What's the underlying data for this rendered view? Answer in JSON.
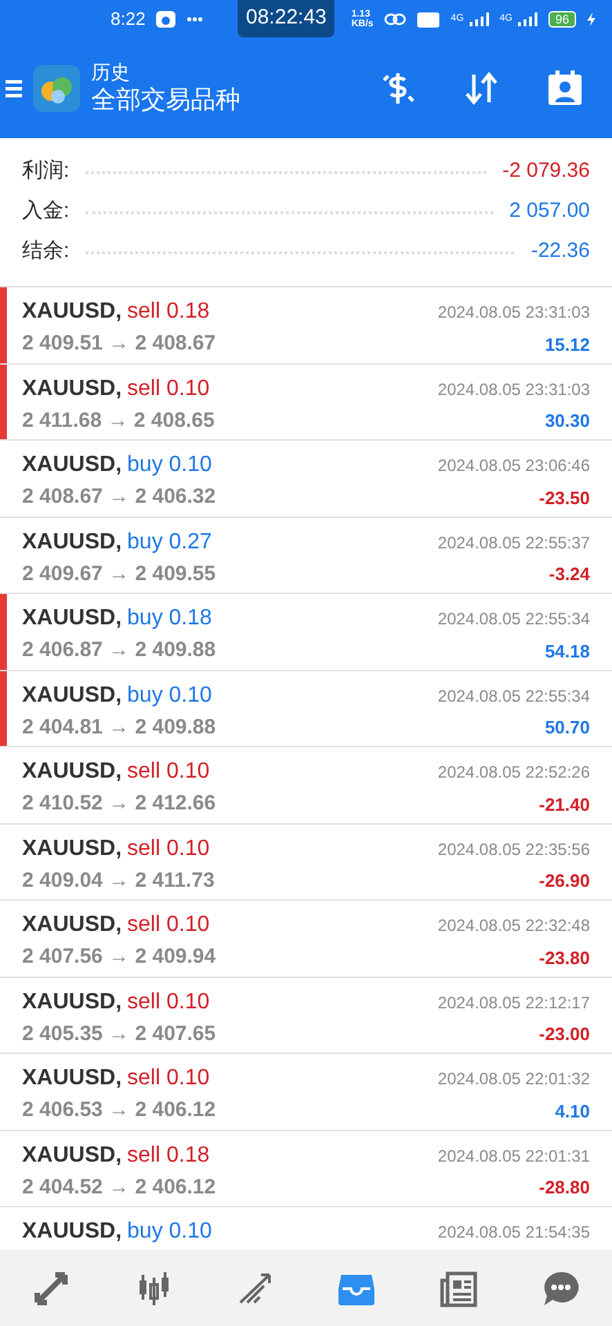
{
  "status_bar": {
    "time": "8:22",
    "clock_overlay": "08:22:43",
    "speed": "1.13\nKB/s",
    "network_1": "4G",
    "network_2": "4G",
    "battery": "96"
  },
  "header": {
    "subtitle": "历史",
    "title": "全部交易品种"
  },
  "summary": [
    {
      "label": "利润:",
      "value": "-2 079.36",
      "color": "#d32027"
    },
    {
      "label": "入金:",
      "value": "2 057.00",
      "color": "#1e78e6"
    },
    {
      "label": "结余:",
      "value": "-22.36",
      "color": "#1e78e6"
    }
  ],
  "trades": [
    {
      "symbol": "XAUUSD,",
      "action": "sell 0.18",
      "color": "#d32027",
      "prices": "2 409.51 → 2 408.67",
      "time": "2024.08.05 23:31:03",
      "profit": "15.12",
      "loss": false,
      "flagged": true
    },
    {
      "symbol": "XAUUSD,",
      "action": "sell 0.10",
      "color": "#d32027",
      "prices": "2 411.68 → 2 408.65",
      "time": "2024.08.05 23:31:03",
      "profit": "30.30",
      "loss": false,
      "flagged": true
    },
    {
      "symbol": "XAUUSD,",
      "action": "buy 0.10",
      "color": "#1e78e6",
      "prices": "2 408.67 → 2 406.32",
      "time": "2024.08.05 23:06:46",
      "profit": "-23.50",
      "loss": true,
      "flagged": false
    },
    {
      "symbol": "XAUUSD,",
      "action": "buy 0.27",
      "color": "#1e78e6",
      "prices": "2 409.67 → 2 409.55",
      "time": "2024.08.05 22:55:37",
      "profit": "-3.24",
      "loss": true,
      "flagged": false
    },
    {
      "symbol": "XAUUSD,",
      "action": "buy 0.18",
      "color": "#1e78e6",
      "prices": "2 406.87 → 2 409.88",
      "time": "2024.08.05 22:55:34",
      "profit": "54.18",
      "loss": false,
      "flagged": true
    },
    {
      "symbol": "XAUUSD,",
      "action": "buy 0.10",
      "color": "#1e78e6",
      "prices": "2 404.81 → 2 409.88",
      "time": "2024.08.05 22:55:34",
      "profit": "50.70",
      "loss": false,
      "flagged": true
    },
    {
      "symbol": "XAUUSD,",
      "action": "sell 0.10",
      "color": "#d32027",
      "prices": "2 410.52 → 2 412.66",
      "time": "2024.08.05 22:52:26",
      "profit": "-21.40",
      "loss": true,
      "flagged": false
    },
    {
      "symbol": "XAUUSD,",
      "action": "sell 0.10",
      "color": "#d32027",
      "prices": "2 409.04 → 2 411.73",
      "time": "2024.08.05 22:35:56",
      "profit": "-26.90",
      "loss": true,
      "flagged": false
    },
    {
      "symbol": "XAUUSD,",
      "action": "sell 0.10",
      "color": "#d32027",
      "prices": "2 407.56 → 2 409.94",
      "time": "2024.08.05 22:32:48",
      "profit": "-23.80",
      "loss": true,
      "flagged": false
    },
    {
      "symbol": "XAUUSD,",
      "action": "sell 0.10",
      "color": "#d32027",
      "prices": "2 405.35 → 2 407.65",
      "time": "2024.08.05 22:12:17",
      "profit": "-23.00",
      "loss": true,
      "flagged": false
    },
    {
      "symbol": "XAUUSD,",
      "action": "sell 0.10",
      "color": "#d32027",
      "prices": "2 406.53 → 2 406.12",
      "time": "2024.08.05 22:01:32",
      "profit": "4.10",
      "loss": false,
      "flagged": false
    },
    {
      "symbol": "XAUUSD,",
      "action": "sell 0.18",
      "color": "#d32027",
      "prices": "2 404.52 → 2 406.12",
      "time": "2024.08.05 22:01:31",
      "profit": "-28.80",
      "loss": true,
      "flagged": false
    },
    {
      "symbol": "XAUUSD,",
      "action": "buy 0.10",
      "color": "#1e78e6",
      "time": "2024.08.05 21:54:35",
      "flagged": false
    }
  ],
  "bottom_nav": [
    {
      "kind": "quotes",
      "selected": false
    },
    {
      "kind": "chart",
      "selected": false
    },
    {
      "kind": "trade",
      "selected": false
    },
    {
      "kind": "history",
      "selected": true
    },
    {
      "kind": "news",
      "selected": false
    },
    {
      "kind": "chat",
      "selected": false
    }
  ]
}
